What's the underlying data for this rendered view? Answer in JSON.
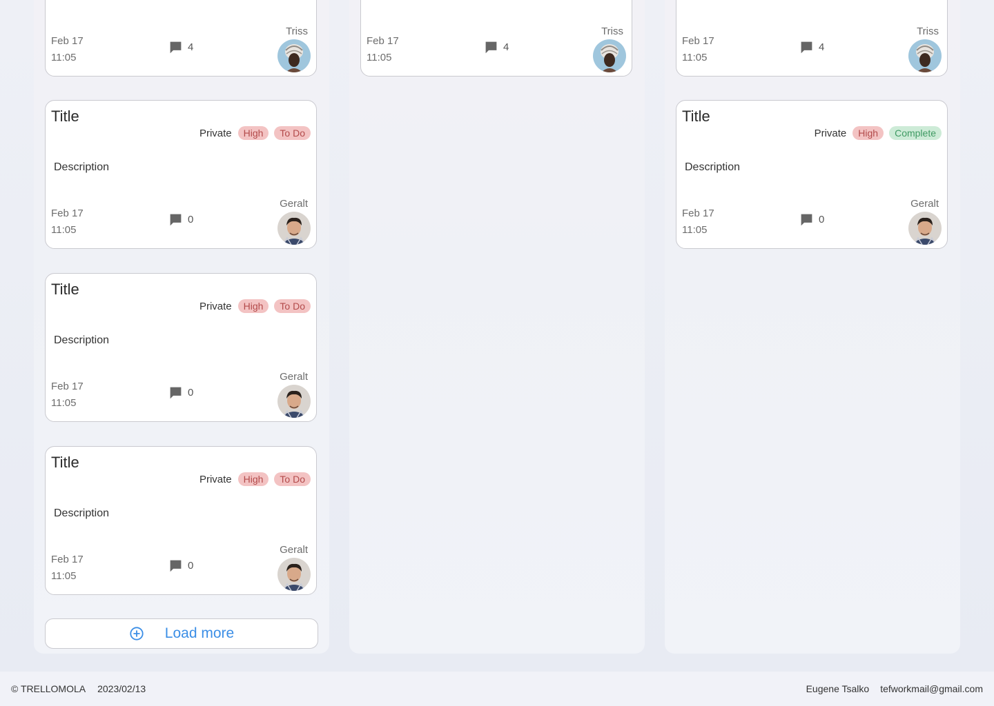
{
  "columns": [
    {
      "cards": [
        {
          "title": "",
          "visibility": "",
          "priority": "",
          "status": "",
          "description": "",
          "date": "Feb 17",
          "time": "11:05",
          "comments": "4",
          "user": "Triss",
          "avatar": "triss"
        },
        {
          "title": "Title",
          "visibility": "Private",
          "priority": "High",
          "status": "To Do",
          "description": "Description",
          "date": "Feb 17",
          "time": "11:05",
          "comments": "0",
          "user": "Geralt",
          "avatar": "geralt"
        },
        {
          "title": "Title",
          "visibility": "Private",
          "priority": "High",
          "status": "To Do",
          "description": "Description",
          "date": "Feb 17",
          "time": "11:05",
          "comments": "0",
          "user": "Geralt",
          "avatar": "geralt"
        },
        {
          "title": "Title",
          "visibility": "Private",
          "priority": "High",
          "status": "To Do",
          "description": "Description",
          "date": "Feb 17",
          "time": "11:05",
          "comments": "0",
          "user": "Geralt",
          "avatar": "geralt"
        }
      ],
      "load_more_label": "Load more"
    },
    {
      "cards": [
        {
          "title": "",
          "visibility": "",
          "priority": "",
          "status": "",
          "description": "",
          "date": "Feb 17",
          "time": "11:05",
          "comments": "4",
          "user": "Triss",
          "avatar": "triss"
        }
      ]
    },
    {
      "cards": [
        {
          "title": "",
          "visibility": "",
          "priority": "",
          "status": "",
          "description": "",
          "date": "Feb 17",
          "time": "11:05",
          "comments": "4",
          "user": "Triss",
          "avatar": "triss"
        },
        {
          "title": "Title",
          "visibility": "Private",
          "priority": "High",
          "status": "Complete",
          "description": "Description",
          "date": "Feb 17",
          "time": "11:05",
          "comments": "0",
          "user": "Geralt",
          "avatar": "geralt"
        }
      ]
    }
  ],
  "icons": {
    "comment": "comment-icon",
    "add": "add-circle-icon"
  },
  "colors": {
    "accent": "#3b8ee6",
    "high_badge": "#f3c3c3",
    "complete_badge": "#cdebd7"
  },
  "footer": {
    "copyright": "© TRELLOMOLA",
    "date": "2023/02/13",
    "author": "Eugene Tsalko",
    "email": "tefworkmail@gmail.com"
  }
}
